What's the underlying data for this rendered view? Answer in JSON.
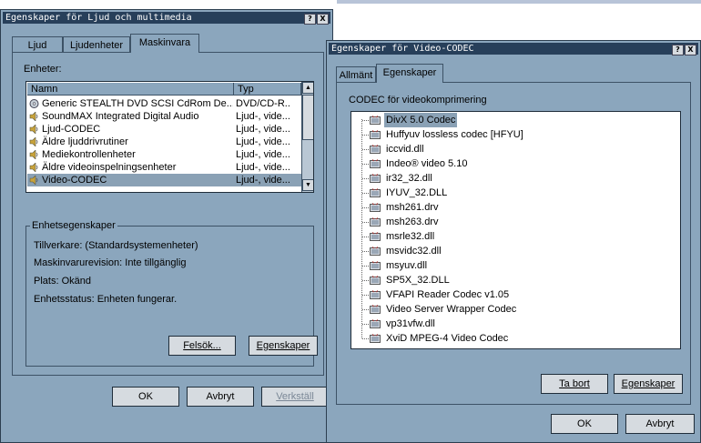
{
  "audio_dialog": {
    "title": "Egenskaper för Ljud och multimedia",
    "tabs": [
      {
        "label": "Ljud"
      },
      {
        "label": "Ljudenheter"
      },
      {
        "label": "Maskinvara"
      }
    ],
    "devices_label": "Enheter:",
    "columns": {
      "name": "Namn",
      "type": "Typ"
    },
    "devices": [
      {
        "name": "Generic STEALTH DVD SCSI CdRom De...",
        "type": "DVD/CD-R..."
      },
      {
        "name": "SoundMAX Integrated Digital Audio",
        "type": "Ljud-, vide..."
      },
      {
        "name": "Ljud-CODEC",
        "type": "Ljud-, vide..."
      },
      {
        "name": "Äldre ljuddrivrutiner",
        "type": "Ljud-, vide..."
      },
      {
        "name": "Mediekontrollenheter",
        "type": "Ljud-, vide..."
      },
      {
        "name": "Äldre videoinspelningsenheter",
        "type": "Ljud-, vide..."
      },
      {
        "name": "Video-CODEC",
        "type": "Ljud-, vide..."
      }
    ],
    "group_label": "Enhetsegenskaper",
    "manufacturer": "Tillverkare: (Standardsystemenheter)",
    "hw_revision": "Maskinvarurevision: Inte tillgänglig",
    "location": "Plats: Okänd",
    "status": "Enhetsstatus: Enheten fungerar.",
    "troubleshoot_button": "Felsök...",
    "properties_button": "Egenskaper",
    "ok_button": "OK",
    "cancel_button": "Avbryt",
    "apply_button": "Verkställ"
  },
  "codec_dialog": {
    "title": "Egenskaper för Video-CODEC",
    "tabs": [
      {
        "label": "Allmänt"
      },
      {
        "label": "Egenskaper"
      }
    ],
    "section_label": "CODEC för videokomprimering",
    "codecs": [
      "DivX 5.0 Codec",
      "Huffyuv lossless codec [HFYU]",
      "iccvid.dll",
      "Indeo® video 5.10",
      "ir32_32.dll",
      "IYUV_32.DLL",
      "msh261.drv",
      "msh263.drv",
      "msrle32.dll",
      "msvidc32.dll",
      "msyuv.dll",
      "SP5X_32.DLL",
      "VFAPI Reader Codec v1.05",
      "Video Server Wrapper Codec",
      "vp31vfw.dll",
      "XviD MPEG-4 Video Codec"
    ],
    "remove_button": "Ta bort",
    "properties_button": "Egenskaper",
    "ok_button": "OK",
    "cancel_button": "Avbryt"
  },
  "title_buttons": {
    "help": "?",
    "close": "X"
  }
}
